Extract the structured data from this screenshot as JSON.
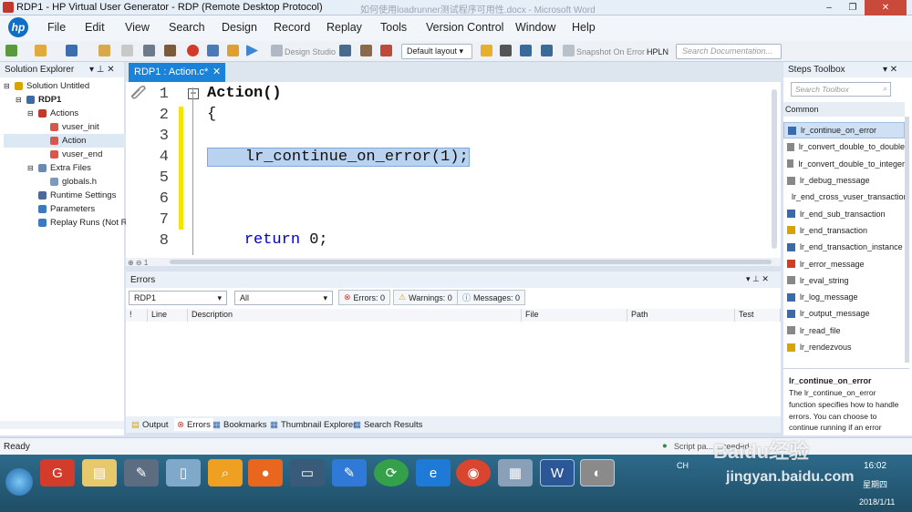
{
  "window": {
    "title": "RDP1 - HP Virtual User Generator - RDP (Remote Desktop Protocol)",
    "ghost_title": "如何使用loadrunner测试程序可用性.docx - Microsoft Word",
    "controls": [
      "–",
      "❐",
      "✕"
    ]
  },
  "menu": [
    "File",
    "Edit",
    "View",
    "Search",
    "Design",
    "Record",
    "Replay",
    "Tools",
    "Version Control",
    "Window",
    "Help"
  ],
  "toolbar": {
    "design_studio": "Design Studio",
    "layout": "Default layout",
    "snapshot": "Snapshot On Error",
    "hpln": "HPLN",
    "doc_search_placeholder": "Search Documentation..."
  },
  "solution_explorer": {
    "title": "Solution Explorer",
    "tree": [
      {
        "label": "Solution Untitled",
        "level": 0,
        "bold": false,
        "icon": "solution-icon"
      },
      {
        "label": "RDP1",
        "level": 1,
        "bold": true,
        "icon": "script-icon"
      },
      {
        "label": "Actions",
        "level": 2,
        "bold": false,
        "icon": "actions-icon"
      },
      {
        "label": "vuser_init",
        "level": 3,
        "bold": false,
        "icon": "action-icon"
      },
      {
        "label": "Action",
        "level": 3,
        "bold": false,
        "icon": "action-icon",
        "selected": true
      },
      {
        "label": "vuser_end",
        "level": 3,
        "bold": false,
        "icon": "action-icon"
      },
      {
        "label": "Extra Files",
        "level": 2,
        "bold": false,
        "icon": "folder-icon"
      },
      {
        "label": "globals.h",
        "level": 3,
        "bold": false,
        "icon": "file-icon"
      },
      {
        "label": "Runtime Settings",
        "level": 2,
        "bold": false,
        "icon": "settings-icon"
      },
      {
        "label": "Parameters",
        "level": 2,
        "bold": false,
        "icon": "parameters-icon"
      },
      {
        "label": "Replay Runs (Not Run",
        "level": 2,
        "bold": false,
        "icon": "replay-icon"
      }
    ]
  },
  "editor": {
    "tab_label": "RDP1 : Action.c*",
    "lines": [
      {
        "n": "1",
        "code": "Action()",
        "fold": true
      },
      {
        "n": "2",
        "code": "{"
      },
      {
        "n": "3",
        "code": ""
      },
      {
        "n": "4",
        "code": "    lr_continue_on_error(1);",
        "selected": true
      },
      {
        "n": "5",
        "code": ""
      },
      {
        "n": "6",
        "code": ""
      },
      {
        "n": "7",
        "code": ""
      },
      {
        "n": "8",
        "code": "    return 0;"
      }
    ]
  },
  "errors": {
    "title": "Errors",
    "script_filter": "RDP1",
    "scope_filter": "All",
    "errors_btn": "Errors: 0",
    "warnings_btn": "Warnings: 0",
    "messages_btn": "Messages: 0",
    "columns": [
      "!",
      "Line",
      "Description",
      "File",
      "Path",
      "Test"
    ]
  },
  "bottom_tabs": [
    "Output",
    "Errors",
    "Bookmarks",
    "Thumbnail Explorer",
    "Search Results"
  ],
  "steps_toolbox": {
    "title": "Steps Toolbox",
    "search_placeholder": "Search Toolbox",
    "category": "Common",
    "items": [
      "lr_continue_on_error",
      "lr_convert_double_to_double",
      "lr_convert_double_to_integer",
      "lr_debug_message",
      "lr_end_cross_vuser_transaction",
      "lr_end_sub_transaction",
      "lr_end_transaction",
      "lr_end_transaction_instance",
      "lr_error_message",
      "lr_eval_string",
      "lr_log_message",
      "lr_output_message",
      "lr_read_file",
      "lr_rendezvous"
    ],
    "description_title": "lr_continue_on_error",
    "description_text": "The lr_continue_on_error function specifies how to handle errors. You can choose to continue running if an error"
  },
  "status": {
    "left": "Ready",
    "right": "Script pa... ...ceeded"
  },
  "taskbar": {
    "clock_time": "16:02",
    "clock_day": "星期四",
    "clock_date": "2018/1/11",
    "lang": "CH"
  },
  "watermark": {
    "brand": "Baidu经验",
    "url": "jingyan.baidu.com"
  }
}
